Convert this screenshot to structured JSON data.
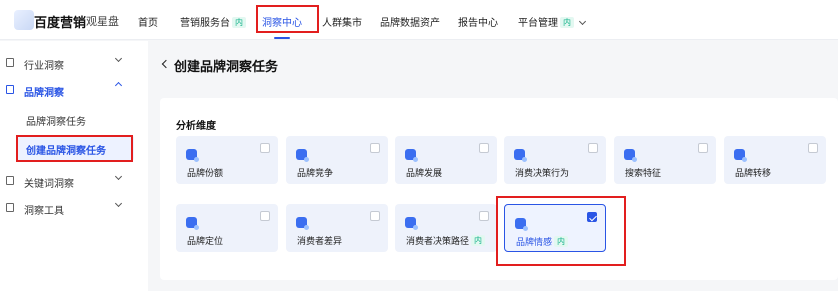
{
  "header": {
    "brand": "百度营销",
    "product": "观星盘",
    "nav": [
      {
        "label": "首页",
        "badge": ""
      },
      {
        "label": "营销服务台",
        "badge": "内"
      },
      {
        "label": "洞察中心",
        "badge": ""
      },
      {
        "label": "人群集市",
        "badge": ""
      },
      {
        "label": "品牌数据资产",
        "badge": ""
      },
      {
        "label": "报告中心",
        "badge": ""
      },
      {
        "label": "平台管理",
        "badge": "内"
      }
    ],
    "active_nav": "洞察中心"
  },
  "sidebar": {
    "items": [
      {
        "label": "行业洞察",
        "expanded": false
      },
      {
        "label": "品牌洞察",
        "expanded": true
      },
      {
        "label": "关键词洞察",
        "expanded": false
      },
      {
        "label": "洞察工具",
        "expanded": false
      }
    ],
    "sub_items": [
      {
        "label": "品牌洞察任务",
        "active": false
      },
      {
        "label": "创建品牌洞察任务",
        "active": true
      }
    ]
  },
  "main": {
    "title": "创建品牌洞察任务",
    "section_title": "分析维度",
    "dimensions": [
      {
        "label": "品牌份额",
        "badge": "",
        "checked": false
      },
      {
        "label": "品牌竞争",
        "badge": "",
        "checked": false
      },
      {
        "label": "品牌发展",
        "badge": "",
        "checked": false
      },
      {
        "label": "消费决策行为",
        "badge": "",
        "checked": false
      },
      {
        "label": "搜索特征",
        "badge": "",
        "checked": false
      },
      {
        "label": "品牌转移",
        "badge": "",
        "checked": false
      },
      {
        "label": "品牌定位",
        "badge": "",
        "checked": false
      },
      {
        "label": "消费者差异",
        "badge": "",
        "checked": false
      },
      {
        "label": "消费者决策路径",
        "badge": "内",
        "checked": false
      },
      {
        "label": "品牌情感",
        "badge": "内",
        "checked": true
      }
    ]
  },
  "colors": {
    "accent": "#2a55e5",
    "highlight_border": "#e21e1e",
    "badge_text": "#15b38a",
    "card_bg": "#eef2fb"
  }
}
